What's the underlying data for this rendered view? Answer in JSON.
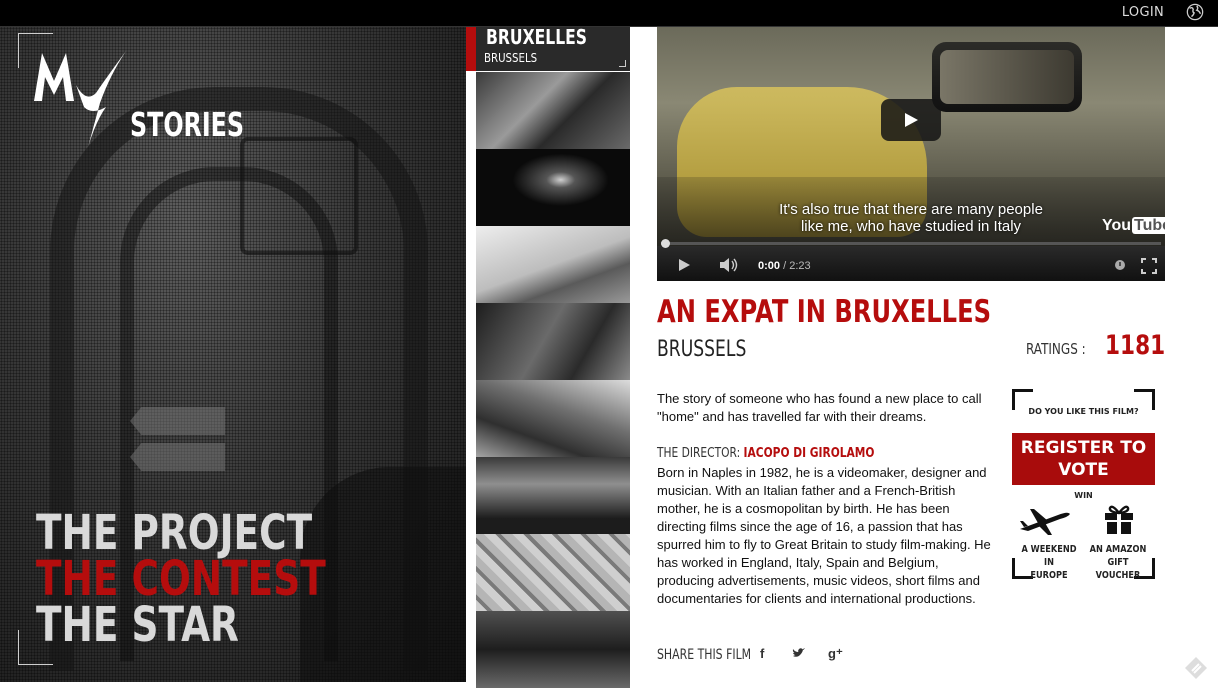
{
  "topbar": {
    "login": "LOGIN",
    "globe_icon": "globe-icon"
  },
  "logo": {
    "mark": "MY",
    "word": "STORIES"
  },
  "hero_menu": [
    {
      "label": "THE PROJECT",
      "active": false
    },
    {
      "label": "THE CONTEST",
      "active": true
    },
    {
      "label": "THE STAR",
      "active": false
    }
  ],
  "gallery": {
    "selected": {
      "title": "BRUXELLES",
      "city": "BRUSSELS"
    },
    "thumbnails": [
      {
        "name": "thumbnail-2"
      },
      {
        "name": "thumbnail-3"
      },
      {
        "name": "thumbnail-4"
      },
      {
        "name": "thumbnail-5"
      },
      {
        "name": "thumbnail-6"
      },
      {
        "name": "thumbnail-7"
      },
      {
        "name": "thumbnail-8"
      },
      {
        "name": "thumbnail-9"
      }
    ]
  },
  "video": {
    "subtitle_line1": "It's also true that there are many people",
    "subtitle_line2": "like me, who have studied in Italy",
    "time_current": "0:00",
    "time_total": "/ 2:23",
    "youtube_you": "You",
    "youtube_tube": "Tube",
    "progress": 0
  },
  "film": {
    "title": "AN EXPAT IN BRUXELLES",
    "city": "BRUSSELS",
    "ratings_label": "RATINGS :",
    "ratings_value": "1181",
    "description": "The story of someone who has found a new place to call \"home\" and has travelled far with their dreams.",
    "director_label": "THE DIRECTOR:",
    "director_name": "IACOPO DI GIROLAMO",
    "bio": "Born in Naples in 1982, he is a videomaker, designer and musician. With an Italian father and a French-British mother, he is a cosmopolitan by birth. He has been directing films since the age of 16, a passion that has spurred him to fly to Great Britain to study film-making. He has worked in England, Italy, Spain and Belgium, producing advertisements, music videos, short films and documentaries for clients and international productions.",
    "share_label": "SHARE THIS FILM",
    "share_facebook": "f",
    "share_twitter": "t",
    "share_gplus": "g⁺"
  },
  "vote": {
    "question": "DO YOU LIKE THIS FILM?",
    "register_line1": "REGISTER TO",
    "register_line2": "VOTE",
    "win": "WIN",
    "prize1_line1": "A WEEKEND IN",
    "prize1_line2": "EUROPE",
    "prize2_line1": "AN AMAZON",
    "prize2_line2": "GIFT VOUCHER"
  },
  "colors": {
    "accent": "#b50d0d",
    "dark": "#000000",
    "hero_text": "#d9d9d9"
  }
}
